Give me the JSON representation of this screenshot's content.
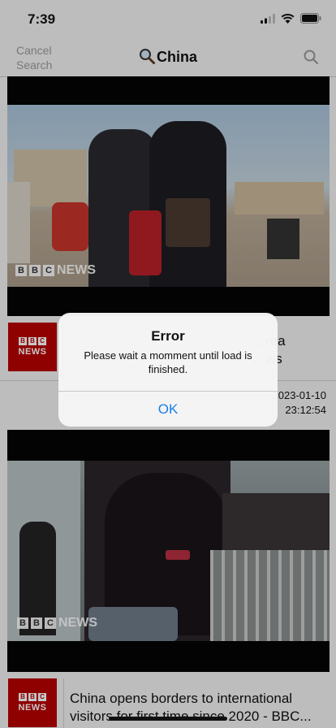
{
  "status_bar": {
    "time": "7:39"
  },
  "nav": {
    "cancel_label": "Cancel\nSearch",
    "title": "China"
  },
  "articles": [
    {
      "headline": "…rea\n…ws",
      "date": "2023-01-10\n23:12:54",
      "watermark": "NEWS",
      "source_logo": "BBC NEWS"
    },
    {
      "headline": "China opens borders to international visitors for first time since 2020 - BBC...",
      "watermark": "NEWS",
      "source_logo": "BBC NEWS"
    }
  ],
  "alert": {
    "title": "Error",
    "message": "Please wait a momment until load is finished.",
    "ok_label": "OK"
  },
  "colors": {
    "alert_button": "#1a7ee6",
    "bbc_red": "#b80000"
  }
}
